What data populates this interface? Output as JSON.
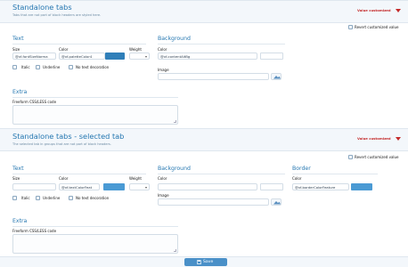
{
  "save_label": "Save",
  "revert_label": "Revert customized value",
  "colors": {
    "accent": "#2577b1",
    "customized": "#c42a2a",
    "swatch_blue": "#4a9ad4",
    "save_button": "#4a90c8"
  },
  "section1": {
    "title": "Standalone tabs",
    "description": "Tabs that are not part of block headers are styled here.",
    "value_customized": "Value customized",
    "text": {
      "label": "Text",
      "size_label": "Size",
      "size_value": "@xf-fontSizeNorma",
      "color_label": "Color",
      "color_value": "@xf-paletteColor4",
      "weight_label": "Weight",
      "italic_label": "Italic",
      "underline_label": "Underline",
      "no_decoration_label": "No text decoration"
    },
    "background": {
      "label": "Background",
      "color_label": "Color",
      "color_value": "@xf-contentAltBg",
      "image_label": "Image"
    },
    "extra": {
      "label": "Extra",
      "freeform_label": "Freeform CSS/LESS code"
    }
  },
  "section2": {
    "title": "Standalone tabs - selected tab",
    "description": "The selected tab in groups that are not part of block headers.",
    "value_customized": "Value customized",
    "text": {
      "label": "Text",
      "size_label": "Size",
      "color_label": "Color",
      "color_value": "@xf-textColorFeat",
      "weight_label": "Weight",
      "italic_label": "Italic",
      "underline_label": "Underline",
      "no_decoration_label": "No text decoration"
    },
    "background": {
      "label": "Background",
      "color_label": "Color",
      "image_label": "Image"
    },
    "border": {
      "label": "Border",
      "color_label": "Color",
      "color_value": "@xf-borderColorFeature"
    },
    "extra": {
      "label": "Extra",
      "freeform_label": "Freeform CSS/LESS code"
    }
  }
}
